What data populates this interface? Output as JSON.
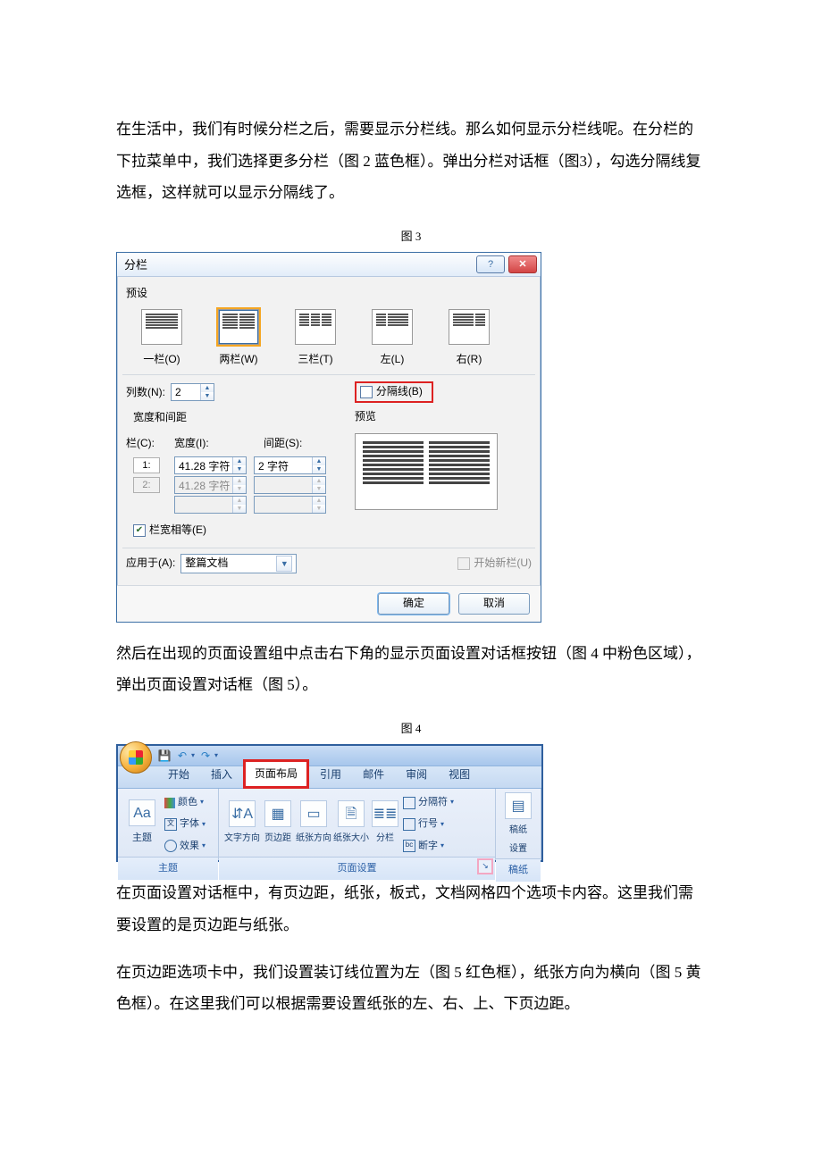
{
  "text": {
    "p1": "在生活中，我们有时候分栏之后，需要显示分栏线。那么如何显示分栏线呢。在分栏的下拉菜单中，我们选择更多分栏（图 2 蓝色框）。弹出分栏对话框（图3），勾选分隔线复选框，这样就可以显示分隔线了。",
    "cap3": "图 3",
    "p2": "然后在出现的页面设置组中点击右下角的显示页面设置对话框按钮（图 4 中粉色区域），弹出页面设置对话框（图 5）。",
    "cap4": "图 4",
    "p3": "在页面设置对话框中，有页边距，纸张，板式，文档网格四个选项卡内容。这里我们需要设置的是页边距与纸张。",
    "p4": "在页边距选项卡中，我们设置装订线位置为左（图 5 红色框），纸张方向为横向（图 5 黄色框）。在这里我们可以根据需要设置纸张的左、右、上、下页边距。"
  },
  "dialog": {
    "title": "分栏",
    "presets_label": "预设",
    "presets": {
      "one": "一栏(O)",
      "two": "两栏(W)",
      "three": "三栏(T)",
      "left": "左(L)",
      "right": "右(R)"
    },
    "cols_label": "列数(N):",
    "cols_value": "2",
    "separator_label": "分隔线(B)",
    "width_spacing_label": "宽度和间距",
    "preview_label": "预览",
    "col_header_col": "栏(C):",
    "col_header_width": "宽度(I):",
    "col_header_spacing": "间距(S):",
    "row1_idx": "1:",
    "row2_idx": "2:",
    "width_val": "41.28 字符",
    "spacing_val": "2 字符",
    "equal_label": "栏宽相等(E)",
    "apply_label": "应用于(A):",
    "apply_value": "整篇文档",
    "newcol_label": "开始新栏(U)",
    "ok": "确定",
    "cancel": "取消"
  },
  "ribbon": {
    "tabs": {
      "home": "开始",
      "insert": "插入",
      "layout": "页面布局",
      "references": "引用",
      "mailings": "邮件",
      "review": "审阅",
      "view": "视图"
    },
    "theme_group": {
      "big": "主题",
      "colors": "颜色",
      "fonts": "字体",
      "effects": "效果",
      "label": "主题"
    },
    "page_setup": {
      "orientation": "文字方向",
      "margins": "页边距",
      "direction": "纸张方向",
      "size": "纸张大小",
      "columns": "分栏",
      "breaks": "分隔符",
      "line_numbers": "行号",
      "hyphenation": "断字",
      "label": "页面设置"
    },
    "paper": {
      "big": "稿纸\n设置",
      "label": "稿纸"
    }
  }
}
